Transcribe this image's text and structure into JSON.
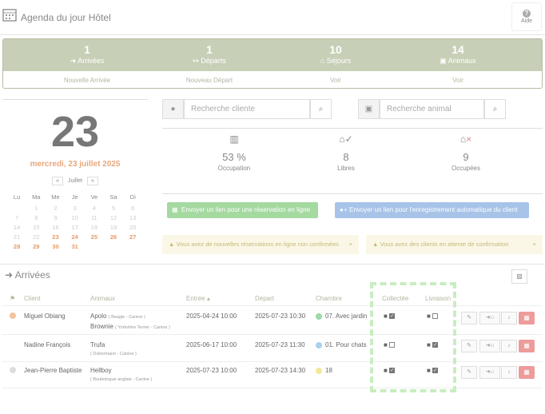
{
  "app": {
    "title": "Agenda du jour Hôtel",
    "help_label": "Aide"
  },
  "stats": [
    {
      "count": "1",
      "label": "Arrivées",
      "action": "Nouvelle Arrivée"
    },
    {
      "count": "1",
      "label": "Départs",
      "action": "Nouveau Départ"
    },
    {
      "count": "10",
      "label": "Séjours",
      "action": "Voir"
    },
    {
      "count": "14",
      "label": "Animaux",
      "action": "Voir"
    }
  ],
  "calendar": {
    "day": "23",
    "date_text": "mercredi, 23 juillet 2025",
    "prev": "«",
    "month": "Juillet",
    "next": "»",
    "weekdays": [
      "Lu",
      "Ma",
      "Me",
      "Je",
      "Ve",
      "Sa",
      "Di"
    ],
    "weeks": [
      [
        "",
        "1",
        "2",
        "3",
        "4",
        "5",
        "6"
      ],
      [
        "7",
        "8",
        "9",
        "10",
        "11",
        "12",
        "13"
      ],
      [
        "14",
        "15",
        "16",
        "17",
        "18",
        "19",
        "20"
      ],
      [
        "21",
        "22",
        "23",
        "24",
        "25",
        "26",
        "27"
      ],
      [
        "28",
        "29",
        "30",
        "31",
        "",
        "",
        ""
      ]
    ]
  },
  "search": {
    "client_placeholder": "Recherche cliente",
    "animal_placeholder": "Recherche animal"
  },
  "occupancy": {
    "pct_value": "53 %",
    "pct_label": "Occupation",
    "free_value": "8",
    "free_label": "Libres",
    "used_value": "9",
    "used_label": "Occupées"
  },
  "links": {
    "online_btn": "Envoyer un lien pour une réservation en ligne",
    "auto_btn": "Envoyer un lien pour l'enregistrement automatique du client"
  },
  "notices": {
    "left": "Vous avez de nouvelles réservations en ligne non confirmées",
    "right": "Vous avez des clients en attente de confirmation"
  },
  "arrivals": {
    "title": "Arrivées",
    "columns": {
      "client": "Client",
      "animals": "Animaux",
      "entry": "Entrée",
      "departure": "Départ",
      "room": "Chambre",
      "collected": "Collectée",
      "delivery": "Livraison"
    },
    "rows": [
      {
        "client": "Miguel Obiang",
        "status_color": "#f6c39a",
        "animals": [
          {
            "name": "Apolo",
            "info": "( Beagle - Canine )"
          },
          {
            "name": "Brownie",
            "info": "( Yorkshire Terrier - Canine )"
          }
        ],
        "entry": "2025-04-24 10:00",
        "departure": "2025-07-23 10:30",
        "room": "07. Avec jardin",
        "room_color": "#9ed8a8",
        "collected": true,
        "delivery": false
      },
      {
        "client": "Nadine François",
        "status_color": "",
        "animals": [
          {
            "name": "Trufa",
            "info": "( Dobermann - Canine )"
          }
        ],
        "entry": "2025-06-17 10:00",
        "departure": "2025-07-23 11:30",
        "room": "01. Pour chats",
        "room_color": "#a8d2ee",
        "collected": false,
        "delivery": true
      },
      {
        "client": "Jean-Pierre Baptiste",
        "status_color": "#dddddd",
        "animals": [
          {
            "name": "Hellboy",
            "info": "( Bouledogue anglais - Canine )"
          }
        ],
        "entry": "2025-07-23 10:00",
        "departure": "2025-07-23 14:30",
        "room": "18",
        "room_color": "#f4e79a",
        "collected": true,
        "delivery": true
      }
    ]
  },
  "colors": {
    "accent": "#c7cfb6",
    "date_orange": "#e9a77d",
    "btn_green": "#a4d9a0",
    "btn_blue": "#a7c3e8",
    "danger": "#ed9b9b"
  }
}
